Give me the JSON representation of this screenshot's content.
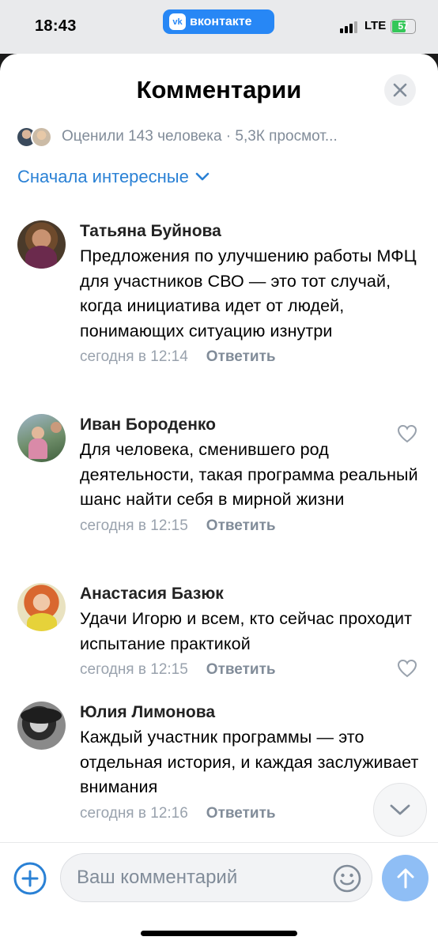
{
  "status_bar": {
    "time": "18:43",
    "app_label": "вконтакте",
    "app_logo": "vk",
    "network": "LTE",
    "battery": "57"
  },
  "header": {
    "title": "Комментарии"
  },
  "stats": {
    "text": "Оценили 143 человека · 5,3К просмот..."
  },
  "sort": {
    "label": "Сначала интересные"
  },
  "comments": [
    {
      "author": "Татьяна Буйнова",
      "text": "Предложения по улучшению работы МФЦ для участников СВО — это тот случай, когда инициатива идет от людей, понимающих ситуацию изнутри",
      "time": "сегодня в 12:14",
      "reply": "Ответить"
    },
    {
      "author": "Иван Бороденко",
      "text": "Для человека, сменившего род деятельности, такая программа реальный шанс найти себя в мирной жизни",
      "time": "сегодня в 12:15",
      "reply": "Ответить"
    },
    {
      "author": "Анастасия Базюк",
      "text": "Удачи Игорю и всем, кто сейчас проходит испытание практикой",
      "time": "сегодня в 12:15",
      "reply": "Ответить"
    },
    {
      "author": "Юлия Лимонова",
      "text": "Каждый участник программы — это отдельная история, и каждая заслуживает внимания",
      "time": "сегодня в 12:16",
      "reply": "Ответить"
    }
  ],
  "composer": {
    "placeholder": "Ваш комментарий"
  },
  "colors": {
    "accent": "#2a81d5",
    "vk_blue": "#2787f5",
    "secondary_text": "#818c99",
    "send_disabled": "#8fbef5"
  }
}
